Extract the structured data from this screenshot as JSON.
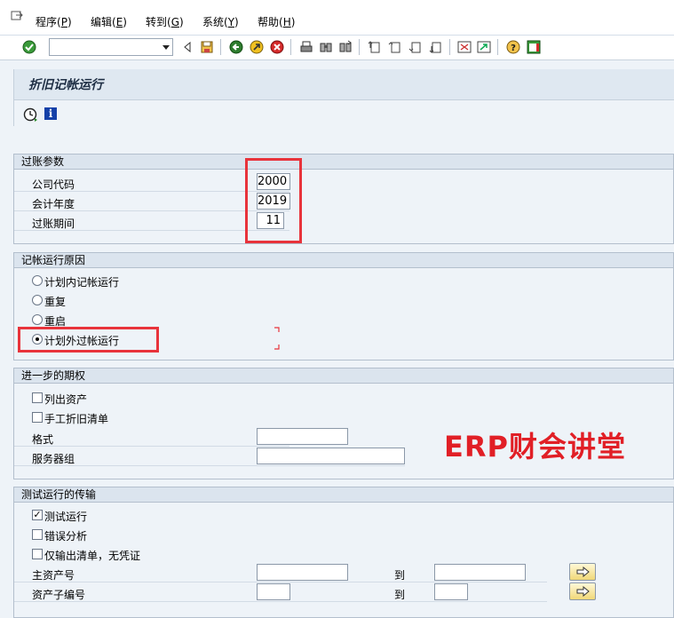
{
  "menu": {
    "items": [
      {
        "label": "程序(",
        "key": "P",
        "tail": ")"
      },
      {
        "label": "编辑(",
        "key": "E",
        "tail": ")"
      },
      {
        "label": "转到(",
        "key": "G",
        "tail": ")"
      },
      {
        "label": "系统(",
        "key": "Y",
        "tail": ")"
      },
      {
        "label": "帮助(",
        "key": "H",
        "tail": ")"
      }
    ]
  },
  "toolbar": {
    "command_value": "",
    "icons": [
      "enter-check-icon",
      "back-icon",
      "save-icon",
      "back-green-icon",
      "exit-yellow-icon",
      "cancel-red-icon",
      "print-icon",
      "find-icon",
      "find-next-icon",
      "first-page-icon",
      "previous-page-icon",
      "next-page-icon",
      "last-page-icon",
      "create-session-icon",
      "shortcut-icon",
      "help-icon",
      "customize-layout-icon"
    ]
  },
  "title": "折旧记帐运行",
  "posting_params": {
    "header": "过账参数",
    "company_code_label": "公司代码",
    "company_code": "2000",
    "fiscal_year_label": "会计年度",
    "fiscal_year": "2019",
    "period_label": "过账期间",
    "period": "11"
  },
  "reason": {
    "header": "记帐运行原因",
    "options": [
      {
        "label": "计划内记帐运行",
        "selected": false
      },
      {
        "label": "重复",
        "selected": false
      },
      {
        "label": "重启",
        "selected": false
      },
      {
        "label": "计划外过帐运行",
        "selected": true
      }
    ]
  },
  "further": {
    "header": "进一步的期权",
    "list_assets_label": "列出资产",
    "list_assets": false,
    "manual_dep_label": "手工折旧清单",
    "manual_dep": false,
    "layout_label": "格式",
    "layout_value": "",
    "server_group_label": "服务器组",
    "server_group_value": ""
  },
  "test_run": {
    "header": "测试运行的传输",
    "test_run_label": "测试运行",
    "test_run": true,
    "error_analysis_label": "错误分析",
    "error_analysis": false,
    "list_only_label": "仅输出清单，无凭证",
    "list_only": false,
    "main_asset_label": "主资产号",
    "main_asset_from": "",
    "main_asset_to_label": "到",
    "main_asset_to": "",
    "sub_asset_label": "资产子编号",
    "sub_asset_from": "",
    "sub_asset_to_label": "到",
    "sub_asset_to": ""
  },
  "watermark": "ERP财会讲堂",
  "colors": {
    "highlight": "#e8333b",
    "watermark": "#e11f26",
    "header_bg": "#dbe4ee"
  }
}
